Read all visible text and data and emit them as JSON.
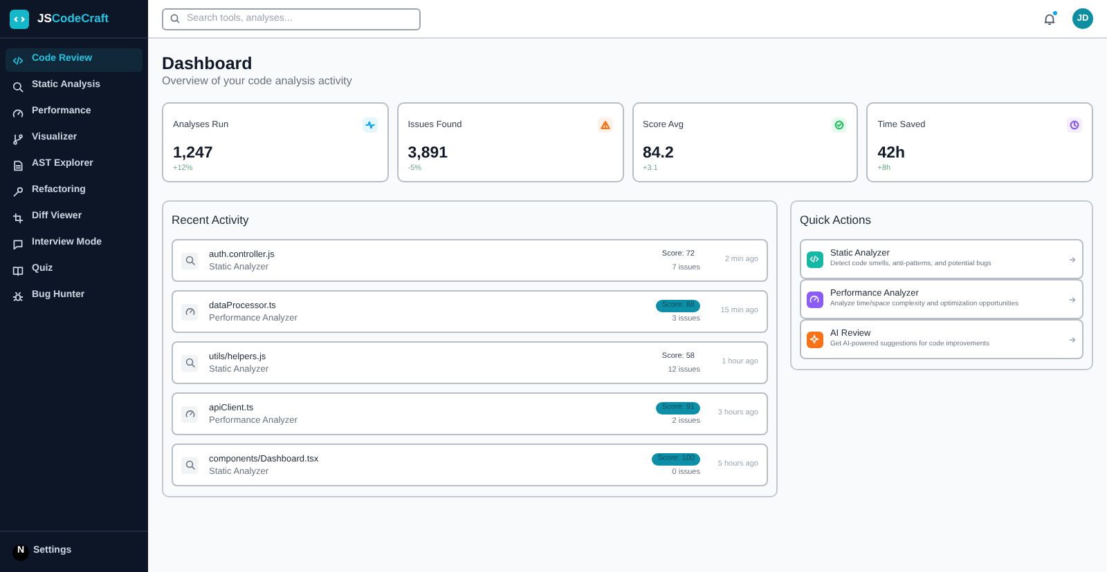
{
  "brand": {
    "prefix": "JS",
    "name": "CodeCraft"
  },
  "nav": [
    {
      "label": "Code Review",
      "selected": true
    },
    {
      "label": "Static Analysis",
      "selected": false
    },
    {
      "label": "Performance",
      "selected": false
    },
    {
      "label": "Visualizer",
      "selected": false
    },
    {
      "label": "AST Explorer",
      "selected": false
    },
    {
      "label": "Refactoring",
      "selected": false
    },
    {
      "label": "Diff Viewer",
      "selected": false
    },
    {
      "label": "Interview Mode",
      "selected": false
    },
    {
      "label": "Quiz",
      "selected": false
    },
    {
      "label": "Bug Hunter",
      "selected": false
    }
  ],
  "settings": {
    "avatar": "N",
    "label": "Settings"
  },
  "search": {
    "placeholder": "Search tools, analyses..."
  },
  "user": {
    "initials": "JD",
    "has_notification": true
  },
  "page": {
    "title": "Dashboard",
    "subtitle": "Overview of your code analysis activity"
  },
  "stats": [
    {
      "label": "Analyses Run",
      "value": "1,247",
      "change": "+12%",
      "color": "#0ea5e9"
    },
    {
      "label": "Issues Found",
      "value": "3,891",
      "change": "-5%",
      "color": "#f97316"
    },
    {
      "label": "Score Avg",
      "value": "84.2",
      "change": "+3.1",
      "color": "#22c55e"
    },
    {
      "label": "Time Saved",
      "value": "42h",
      "change": "+8h",
      "color": "#8b5cf6"
    }
  ],
  "recent": {
    "title": "Recent Activity",
    "items": [
      {
        "file": "auth.controller.js",
        "tool": "Static Analyzer",
        "kind": "static",
        "score": "Score: 72",
        "highlighted": false,
        "issues": "7 issues",
        "time": "2 min ago"
      },
      {
        "file": "dataProcessor.ts",
        "tool": "Performance Analyzer",
        "kind": "performance",
        "score": "Score: 88",
        "highlighted": true,
        "issues": "3 issues",
        "time": "15 min ago"
      },
      {
        "file": "utils/helpers.js",
        "tool": "Static Analyzer",
        "kind": "static",
        "score": "Score: 58",
        "highlighted": false,
        "issues": "12 issues",
        "time": "1 hour ago"
      },
      {
        "file": "apiClient.ts",
        "tool": "Performance Analyzer",
        "kind": "performance",
        "score": "Score: 91",
        "highlighted": true,
        "issues": "2 issues",
        "time": "3 hours ago"
      },
      {
        "file": "components/Dashboard.tsx",
        "tool": "Static Analyzer",
        "kind": "static",
        "score": "Score: 100",
        "highlighted": true,
        "issues": "0 issues",
        "time": "5 hours ago"
      }
    ]
  },
  "quick": {
    "title": "Quick Actions",
    "items": [
      {
        "title": "Static Analyzer",
        "description": "Detect code smells, anti-patterns, and potential bugs",
        "color": "#14b8a6"
      },
      {
        "title": "Performance Analyzer",
        "description": "Analyze time/space complexity and optimization opportunities",
        "color": "#8b5cf6"
      },
      {
        "title": "AI Review",
        "description": "Get AI-powered suggestions for code improvements",
        "color": "#f97316"
      }
    ]
  }
}
